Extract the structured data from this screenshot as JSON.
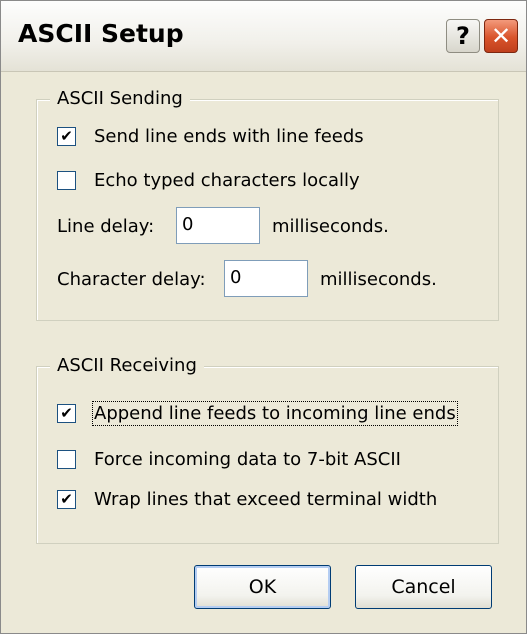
{
  "window": {
    "title": "ASCII Setup",
    "help_glyph": "?",
    "close_glyph": "✕"
  },
  "sending": {
    "legend": "ASCII Sending",
    "send_line_ends": {
      "label": "Send line ends with line feeds",
      "checked": true,
      "glyph": "✔"
    },
    "echo_typed": {
      "label": "Echo typed characters locally",
      "checked": false,
      "glyph": ""
    },
    "line_delay": {
      "label": "Line delay:",
      "value": "0",
      "unit": "milliseconds."
    },
    "char_delay": {
      "label": "Character delay:",
      "value": "0",
      "unit": "milliseconds."
    }
  },
  "receiving": {
    "legend": "ASCII Receiving",
    "append_line_feeds": {
      "label": "Append line feeds to incoming line ends",
      "checked": true,
      "glyph": "✔"
    },
    "force_7bit": {
      "label": "Force incoming data to 7-bit ASCII",
      "checked": false,
      "glyph": ""
    },
    "wrap_lines": {
      "label": "Wrap lines that exceed terminal width",
      "checked": true,
      "glyph": "✔"
    }
  },
  "buttons": {
    "ok": "OK",
    "cancel": "Cancel"
  }
}
